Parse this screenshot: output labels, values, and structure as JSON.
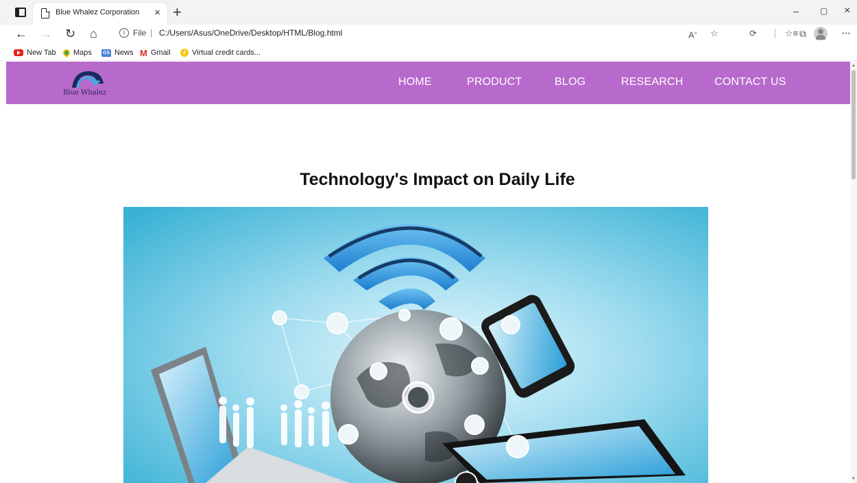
{
  "browser": {
    "tab_title": "Blue Whalez Corporation",
    "tab_close": "×",
    "new_tab": "+",
    "window_controls": {
      "minimize": "–",
      "restore": "▢",
      "close": "×"
    },
    "toolbar": {
      "back": "←",
      "forward": "→",
      "refresh": "↻",
      "home": "⌂",
      "more": "···"
    },
    "address": {
      "scheme_label": "File",
      "separator": "|",
      "url": "C:/Users/Asus/OneDrive/Desktop/HTML/Blog.html"
    },
    "bookmarks": [
      {
        "label": "New Tab",
        "icon": "youtube-icon"
      },
      {
        "label": "Maps",
        "icon": "maps-icon"
      },
      {
        "label": "News",
        "icon": "news-icon"
      },
      {
        "label": "Gmail",
        "icon": "gmail-icon"
      },
      {
        "label": "Virtual credit cards...",
        "icon": "virtual-card-icon"
      }
    ]
  },
  "site": {
    "brand": "Blue Whalez",
    "nav_color": "#b86acc",
    "nav": [
      "HOME",
      "PRODUCT",
      "BLOG",
      "RESEARCH",
      "CONTACT US"
    ]
  },
  "article": {
    "title": "Technology's Impact on Daily Life",
    "hero_colors": {
      "sky_light": "#dff4fb",
      "sky_dark": "#3bb5d6",
      "wifi": "#2e8fe0"
    }
  }
}
